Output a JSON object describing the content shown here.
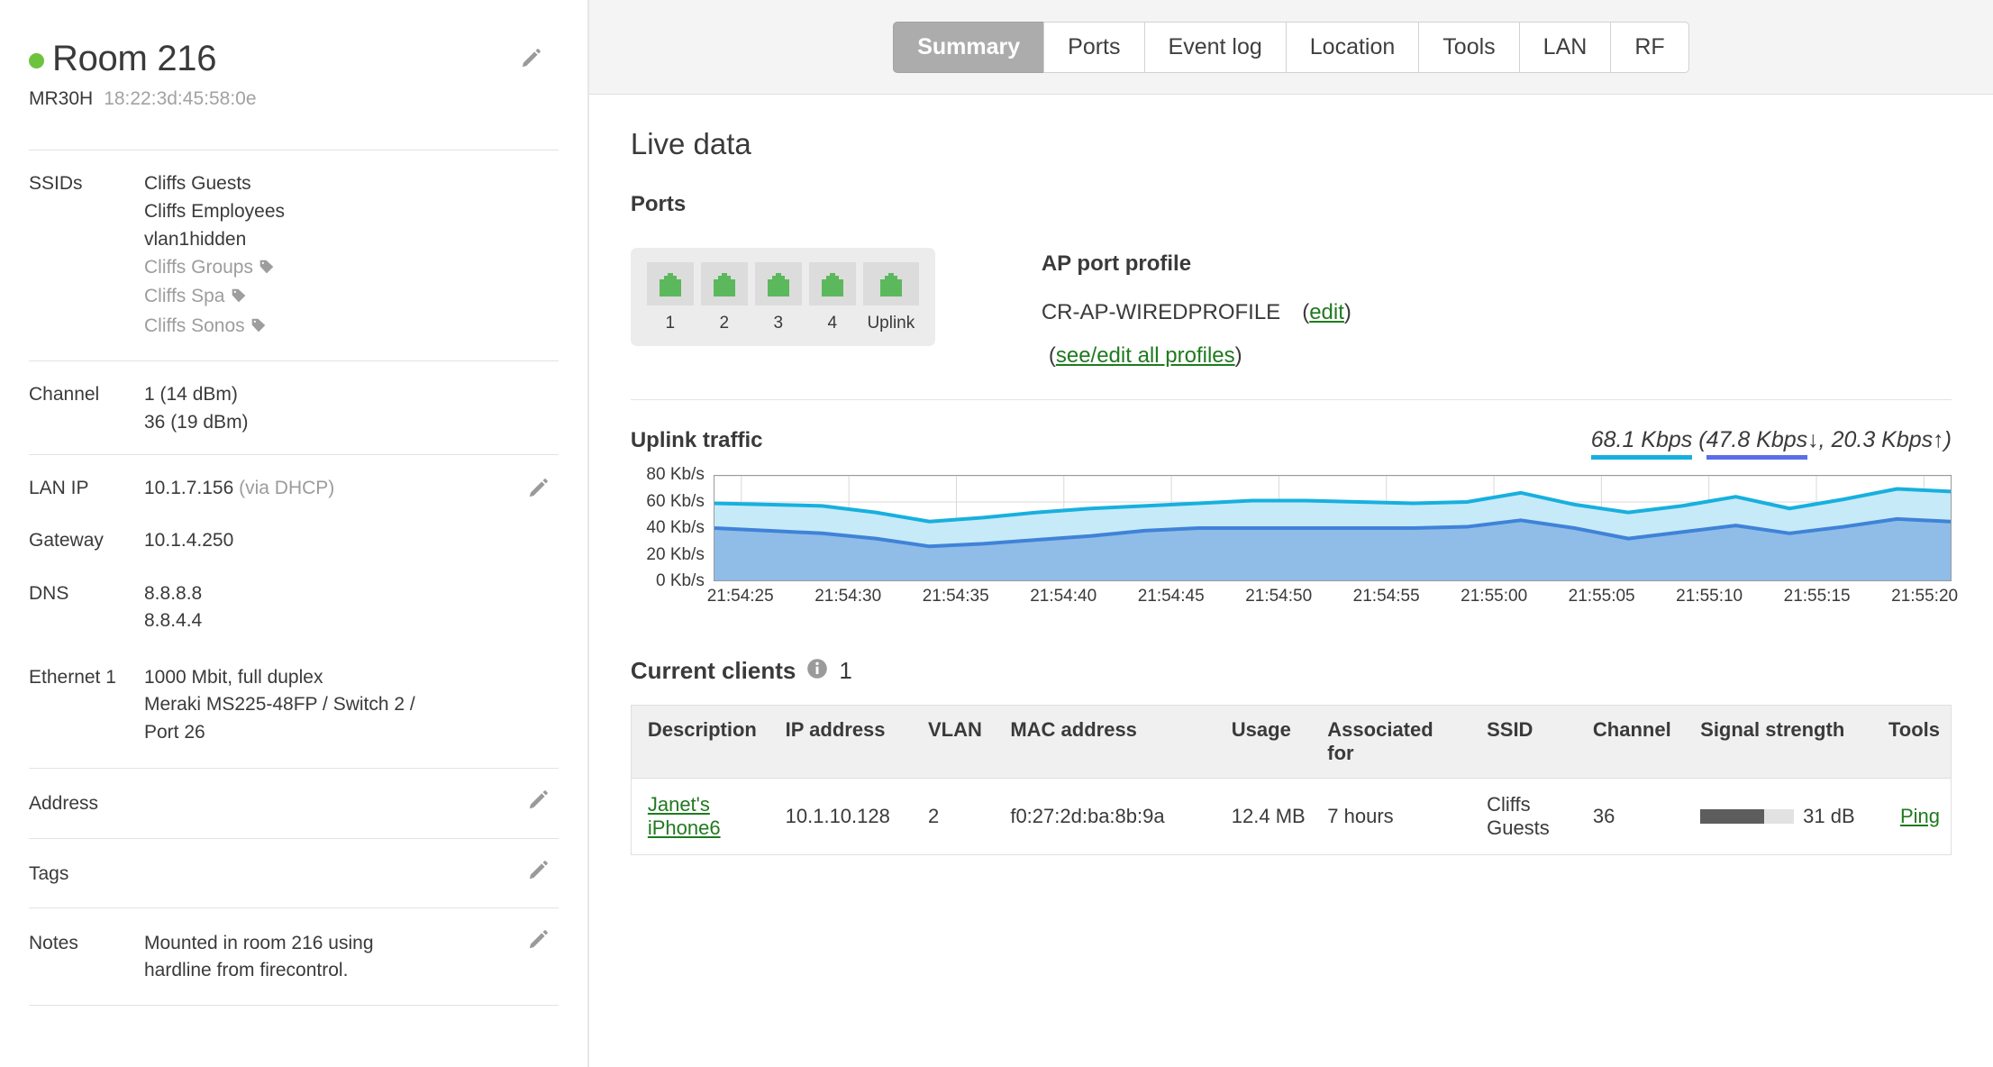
{
  "device": {
    "status": "online",
    "status_color": "#6ec33e",
    "name": "Room 216",
    "model": "MR30H",
    "mac": "18:22:3d:45:58:0e"
  },
  "sidebar": {
    "ssids_label": "SSIDs",
    "ssids": [
      {
        "name": "Cliffs Guests",
        "dimmed": false,
        "tag": false
      },
      {
        "name": "Cliffs Employees",
        "dimmed": false,
        "tag": false
      },
      {
        "name": "vlan1hidden",
        "dimmed": false,
        "tag": false
      },
      {
        "name": "Cliffs Groups",
        "dimmed": true,
        "tag": true
      },
      {
        "name": "Cliffs Spa",
        "dimmed": true,
        "tag": true
      },
      {
        "name": "Cliffs Sonos",
        "dimmed": true,
        "tag": true
      }
    ],
    "channel_label": "Channel",
    "channel_line1": "1 (14 dBm)",
    "channel_line2": "36 (19 dBm)",
    "lanip_label": "LAN IP",
    "lanip_value": "10.1.7.156",
    "lanip_note": "(via DHCP)",
    "gateway_label": "Gateway",
    "gateway_value": "10.1.4.250",
    "dns_label": "DNS",
    "dns_1": "8.8.8.8",
    "dns_2": "8.8.4.4",
    "eth_label": "Ethernet 1",
    "eth_line1": "1000 Mbit, full duplex",
    "eth_line2": "Meraki MS225-48FP / Switch 2 /",
    "eth_line3": "Port 26",
    "address_label": "Address",
    "address_value": "",
    "tags_label": "Tags",
    "tags_value": "",
    "notes_label": "Notes",
    "notes_line1": "Mounted in room 216 using",
    "notes_line2": "hardline from firecontrol."
  },
  "tabs": [
    {
      "label": "Summary",
      "active": true
    },
    {
      "label": "Ports",
      "active": false
    },
    {
      "label": "Event log",
      "active": false
    },
    {
      "label": "Location",
      "active": false
    },
    {
      "label": "Tools",
      "active": false
    },
    {
      "label": "LAN",
      "active": false
    },
    {
      "label": "RF",
      "active": false
    }
  ],
  "main": {
    "live_data_title": "Live data",
    "ports_title": "Ports",
    "ports": [
      {
        "label": "1",
        "state": "up"
      },
      {
        "label": "2",
        "state": "up"
      },
      {
        "label": "3",
        "state": "up"
      },
      {
        "label": "4",
        "state": "up"
      },
      {
        "label": "Uplink",
        "state": "up"
      }
    ],
    "port_up_color": "#5cb85c",
    "ap_profile_title": "AP port profile",
    "ap_profile_name": "CR-AP-WIREDPROFILE",
    "ap_profile_edit": "edit",
    "ap_profile_all": "see/edit all profiles",
    "uplink_title": "Uplink traffic",
    "uplink_total": "68.1 Kbps",
    "uplink_down": "47.8 Kbps",
    "uplink_down_arrow": "↓",
    "uplink_up": "20.3 Kbps",
    "uplink_up_arrow": "↑",
    "clients_title": "Current clients",
    "clients_count": "1"
  },
  "chart_data": {
    "type": "area",
    "title": "Uplink traffic",
    "xlabel": "",
    "ylabel": "Kb/s",
    "ylim": [
      0,
      80
    ],
    "grid": true,
    "yticks": [
      0,
      20,
      40,
      60,
      80
    ],
    "ytick_labels": [
      "0 Kb/s",
      "20 Kb/s",
      "40 Kb/s",
      "60 Kb/s",
      "80 Kb/s"
    ],
    "xtick_labels": [
      "21:54:25",
      "21:54:30",
      "21:54:35",
      "21:54:40",
      "21:54:45",
      "21:54:50",
      "21:54:55",
      "21:55:00",
      "21:55:05",
      "21:55:10",
      "21:55:15",
      "21:55:20"
    ],
    "x": [
      0,
      1,
      2,
      3,
      4,
      5,
      6,
      7,
      8,
      9,
      10,
      11,
      12,
      13,
      14,
      15,
      16,
      17,
      18,
      19,
      20,
      21,
      22,
      23
    ],
    "series": [
      {
        "name": "Total",
        "color": "#17b0de",
        "fill": "#c7eaf8",
        "values": [
          59,
          58,
          57,
          52,
          45,
          48,
          52,
          55,
          57,
          59,
          61,
          61,
          60,
          59,
          60,
          67,
          58,
          52,
          57,
          64,
          55,
          62,
          70,
          68
        ]
      },
      {
        "name": "Downstream",
        "color": "#3f83d8",
        "fill": "#90bce8",
        "values": [
          40,
          38,
          36,
          32,
          26,
          28,
          31,
          34,
          38,
          40,
          40,
          40,
          40,
          40,
          41,
          46,
          40,
          32,
          37,
          42,
          36,
          41,
          47,
          45
        ]
      }
    ],
    "legend_position": "top-right"
  },
  "clients_table": {
    "columns": [
      "Description",
      "IP address",
      "VLAN",
      "MAC address",
      "Usage",
      "Associated for",
      "SSID",
      "Channel",
      "Signal strength",
      "Tools"
    ],
    "rows": [
      {
        "description": "Janet's iPhone6",
        "ip": "10.1.10.128",
        "vlan": "2",
        "mac": "f0:27:2d:ba:8b:9a",
        "usage": "12.4 MB",
        "associated_for": "7 hours",
        "ssid": "Cliffs Guests",
        "channel": "36",
        "signal_db": "31 dB",
        "signal_percent": 68,
        "tools": "Ping"
      }
    ]
  },
  "colors": {
    "accent_green": "#1f7a1f",
    "status_green": "#6ec33e",
    "tab_active_bg": "#acacac",
    "chart_total": "#17b0de",
    "chart_down": "#3f83d8"
  }
}
